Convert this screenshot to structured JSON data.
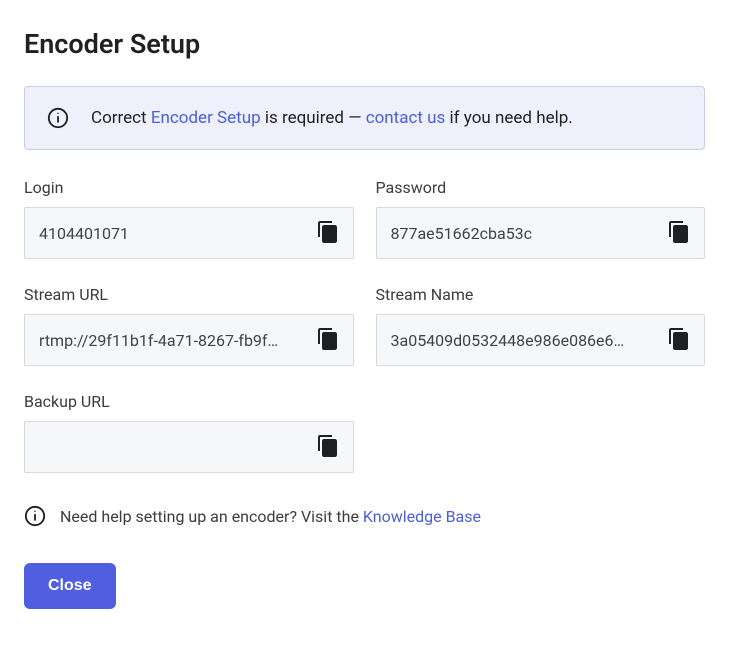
{
  "title": "Encoder Setup",
  "alert": {
    "prefix": "Correct ",
    "link1": "Encoder Setup",
    "middle": " is required — ",
    "link2": "contact us",
    "suffix": " if you need help."
  },
  "fields": {
    "login": {
      "label": "Login",
      "value": "4104401071"
    },
    "password": {
      "label": "Password",
      "value": "877ae51662cba53c"
    },
    "stream_url": {
      "label": "Stream URL",
      "value": "rtmp://29f11b1f-4a71-8267-fb9f…"
    },
    "stream_name": {
      "label": "Stream Name",
      "value": "3a05409d0532448e986e086e6…"
    },
    "backup_url": {
      "label": "Backup URL",
      "value": ""
    }
  },
  "help": {
    "prefix": "Need help setting up an encoder? Visit the ",
    "link": "Knowledge Base"
  },
  "buttons": {
    "close": "Close"
  }
}
